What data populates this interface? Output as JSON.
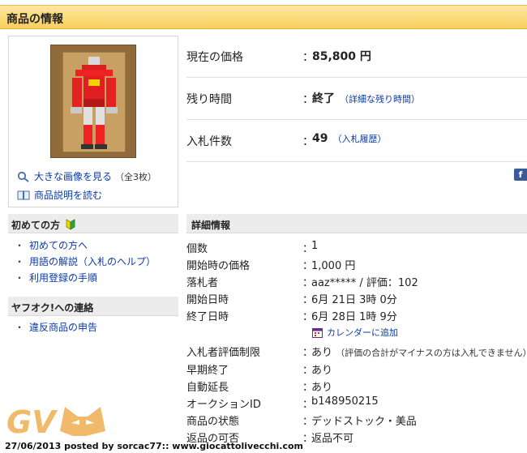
{
  "header": {
    "title": "商品の情報"
  },
  "image_panel": {
    "large_image_link": "大きな画像を見る",
    "image_count": "（全3枚）",
    "description_link": "商品説明を読む"
  },
  "sidebar": {
    "beginner_heading": "初めての方",
    "beginner_links": [
      "初めての方へ",
      "用語の解説（入札のヘルプ）",
      "利用登録の手順"
    ],
    "contact_heading": "ヤフオク!への連絡",
    "contact_links": [
      "違反商品の申告"
    ]
  },
  "summary": {
    "current_price_label": "現在の価格",
    "current_price_value": "85,800 円",
    "time_left_label": "残り時間",
    "time_left_value": "終了",
    "time_left_link": "（詳細な残り時間）",
    "bids_label": "入札件数",
    "bids_value": "49",
    "bids_link": "（入札履歴）",
    "colon": "："
  },
  "details": {
    "heading": "詳細情報",
    "quantity_label": "個数",
    "quantity_value": "1",
    "start_price_label": "開始時の価格",
    "start_price_value": "1,000 円",
    "winner_label": "落札者",
    "winner_value": "aaz***** / 評価：102",
    "start_date_label": "開始日時",
    "start_date_value": "6月 21日 3時 0分",
    "end_date_label": "終了日時",
    "end_date_value": "6月 28日 1時 9分",
    "calendar_link": "カレンダーに追加",
    "rating_limit_label": "入札者評価制限",
    "rating_limit_value": "あり",
    "rating_limit_note": "（評価の合計がマイナスの方は入札できません）",
    "early_end_label": "早期終了",
    "early_end_value": "あり",
    "auto_extend_label": "自動延長",
    "auto_extend_value": "あり",
    "auction_id_label": "オークションID",
    "auction_id_value": "b148950215",
    "condition_label": "商品の状態",
    "condition_value": "デッドストック・美品",
    "returns_label": "返品の可否",
    "returns_value": "返品不可"
  },
  "watermark": {
    "logo_text": "GV",
    "footer": "27/06/2013 posted by sorcac77:: www.giocattolivecchi.com"
  },
  "colors": {
    "header_bar": "#f7cf5a",
    "link": "#0a3aa8",
    "section_bg": "#ececec",
    "facebook": "#3b5998",
    "watermark": "#f0b35a"
  }
}
